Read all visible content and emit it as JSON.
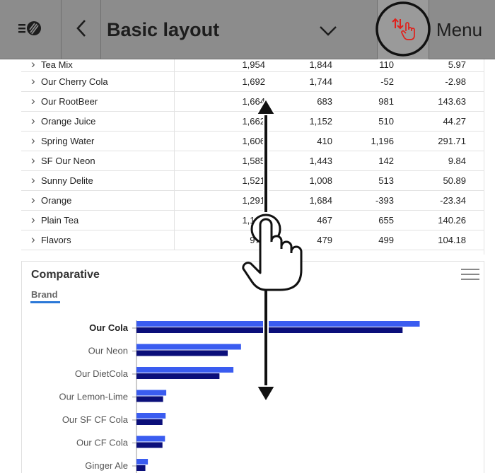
{
  "header": {
    "app_menu_icon": "app-menu-icon",
    "back_icon": "chevron-left-icon",
    "title": "Basic layout",
    "dropdown_icon": "chevron-down-icon",
    "sort_icon": "swap-vertical-hand-icon",
    "menu_label": "Menu"
  },
  "table": {
    "rows": [
      {
        "name": "Tea Mix",
        "c1": "1,954",
        "c2": "1,844",
        "c3": "110",
        "c4": "5.97"
      },
      {
        "name": "Our Cherry Cola",
        "c1": "1,692",
        "c2": "1,744",
        "c3": "-52",
        "c4": "-2.98"
      },
      {
        "name": "Our RootBeer",
        "c1": "1,664",
        "c2": "683",
        "c3": "981",
        "c4": "143.63"
      },
      {
        "name": "Orange Juice",
        "c1": "1,662",
        "c2": "1,152",
        "c3": "510",
        "c4": "44.27"
      },
      {
        "name": "Spring Water",
        "c1": "1,606",
        "c2": "410",
        "c3": "1,196",
        "c4": "291.71"
      },
      {
        "name": "SF Our Neon",
        "c1": "1,585",
        "c2": "1,443",
        "c3": "142",
        "c4": "9.84"
      },
      {
        "name": "Sunny Delite",
        "c1": "1,521",
        "c2": "1,008",
        "c3": "513",
        "c4": "50.89"
      },
      {
        "name": "Orange",
        "c1": "1,291",
        "c2": "1,684",
        "c3": "-393",
        "c4": "-23.34"
      },
      {
        "name": "Plain Tea",
        "c1": "1,122",
        "c2": "467",
        "c3": "655",
        "c4": "140.26"
      },
      {
        "name": "Flavors",
        "c1": "978",
        "c2": "479",
        "c3": "499",
        "c4": "104.18"
      }
    ]
  },
  "comparative": {
    "title": "Comparative",
    "tab": "Brand",
    "menu_icon": "hamburger-icon"
  },
  "chart_data": {
    "type": "bar",
    "orientation": "horizontal",
    "categories": [
      "Our Cola",
      "Our Neon",
      "Our DietCola",
      "Our Lemon-Lime",
      "Our SF CF Cola",
      "Our CF Cola",
      "Ginger Ale"
    ],
    "highlighted_category": "Our Cola",
    "series": [
      {
        "values": [
          447,
          165,
          153,
          47,
          46,
          45,
          18
        ]
      },
      {
        "values": [
          420,
          144,
          131,
          42,
          41,
          41,
          14
        ]
      }
    ],
    "colors": [
      "#3a5cf0",
      "#0b0f7a"
    ],
    "xlim": [
      0,
      500
    ],
    "grid": false,
    "legend": "none"
  },
  "gesture": {
    "hand_icon": "pointer-hand-icon",
    "drag_arrow_icon": "vertical-drag-arrow-icon",
    "highlight_icon": "highlight-circle-icon"
  },
  "colors": {
    "topbar": "#8c8c8c",
    "accent": "#2b78d7",
    "sort_icon": "#e0201b"
  }
}
